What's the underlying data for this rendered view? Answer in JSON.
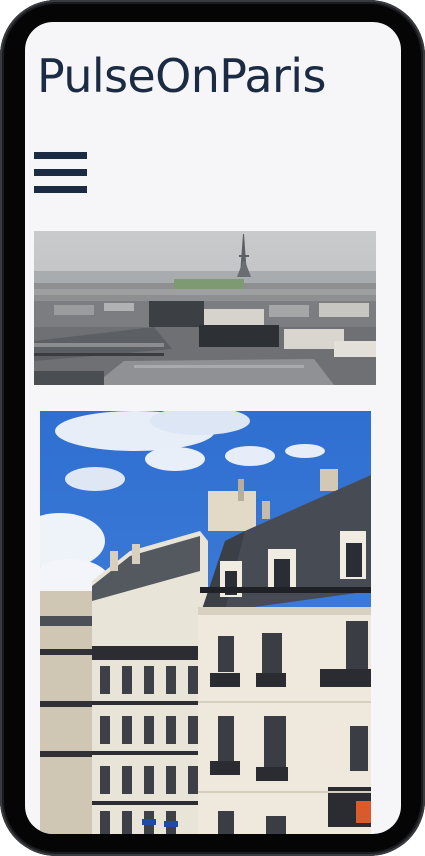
{
  "site": {
    "title": "PulseOnParis"
  },
  "nav": {
    "menu_icon": "hamburger-menu-icon"
  },
  "photos": [
    {
      "name": "paris-skyline-eiffel-tower-photo"
    },
    {
      "name": "haussmann-buildings-photo"
    }
  ],
  "colors": {
    "title": "#1b2b43",
    "background": "#f6f6f8",
    "device_frame": "#111214"
  }
}
